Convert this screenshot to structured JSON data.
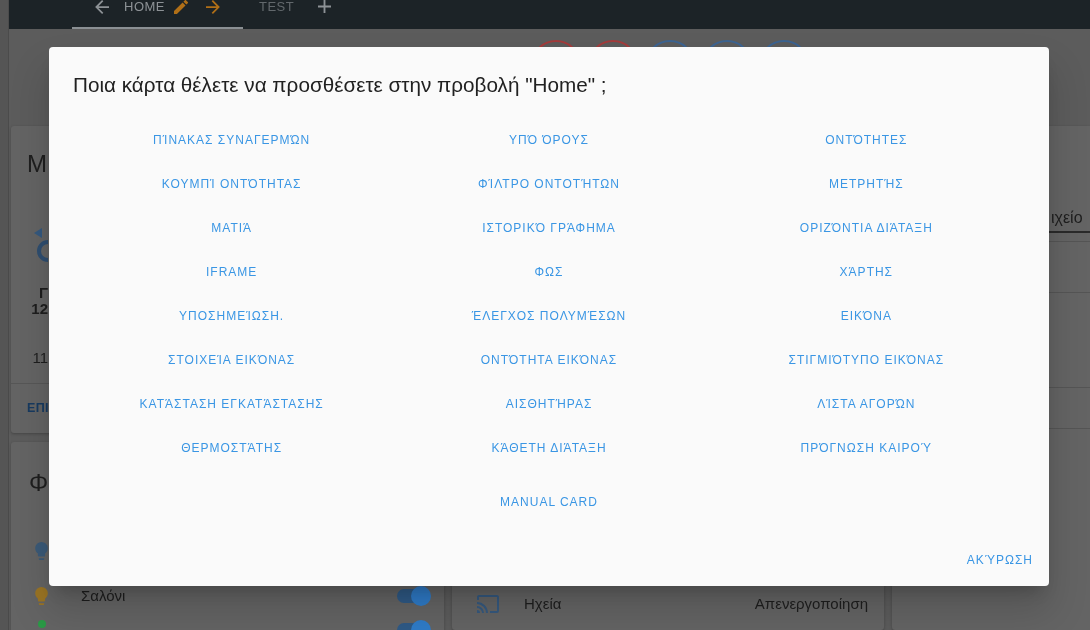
{
  "top_bar": {
    "tabs": [
      {
        "label": "HOME",
        "selected": true
      },
      {
        "label": "TEST",
        "selected": false
      }
    ]
  },
  "badges": [
    {
      "color": "#a33b3b"
    },
    {
      "color": "#a33b3b"
    },
    {
      "color": "#3b6391"
    },
    {
      "color": "#3b6391"
    },
    {
      "color": "#3b6391"
    }
  ],
  "left_column": {
    "summary_card": {
      "title": "M",
      "texts": [
        {
          "text": "Γ",
          "kind": "strong"
        },
        {
          "text": "12",
          "kind": "strong"
        },
        {
          "text": "11",
          "kind": "plain"
        }
      ],
      "action": "ΕΠΙ"
    },
    "lights_card": {
      "title": "Φ",
      "rows": [
        {
          "kind": "light",
          "on": false
        },
        {
          "kind": "light",
          "label": "Σαλόνι",
          "on": true,
          "switch": true
        },
        {
          "kind": "dot",
          "on": true,
          "switch": true
        }
      ]
    }
  },
  "middle_card": {
    "rows": [
      {
        "label": "Ηχεία",
        "value": "Απενεργοποίηση"
      }
    ]
  },
  "right_card": {
    "field_value": "ιχείο"
  },
  "dialog": {
    "title": "Ποια κάρτα θέλετε να προσθέσετε στην προβολή \"Home\" ;",
    "card_types": [
      "ΠΊΝΑΚΑΣ ΣΥΝΑΓΕΡΜΏΝ",
      "ΥΠΌ ΌΡΟΥΣ",
      "ΟΝΤΌΤΗΤΕΣ",
      "ΚΟΥΜΠΊ ΟΝΤΌΤΗΤΑΣ",
      "ΦΊΛΤΡΟ ΟΝΤΟΤΉΤΩΝ",
      "ΜΕΤΡΗΤΉΣ",
      "ΜΑΤΙΆ",
      "ΙΣΤΟΡΙΚΌ ΓΡΆΦΗΜΑ",
      "ΟΡΙΖΌΝΤΙΑ ΔΙΆΤΑΞΗ",
      "IFRAME",
      "ΦΩΣ",
      "ΧΆΡΤΗΣ",
      "ΥΠΟΣΗΜΕΊΩΣΗ.",
      "ΈΛΕΓΧΟΣ ΠΟΛΥΜΈΣΩΝ",
      "ΕΙΚΌΝΑ",
      "ΣΤΟΙΧΕΊΑ ΕΙΚΌΝΑΣ",
      "ΟΝΤΌΤΗΤΑ ΕΙΚΌΝΑΣ",
      "ΣΤΙΓΜΙΌΤΥΠΟ ΕΙΚΌΝΑΣ",
      "ΚΑΤΆΣΤΑΣΗ ΕΓΚΑΤΆΣΤΑΣΗΣ",
      "ΑΙΣΘΗΤΉΡΑΣ",
      "ΛΊΣΤΑ ΑΓΟΡΏΝ",
      "ΘΕΡΜΟΣΤΆΤΗΣ",
      "ΚΆΘΕΤΗ ΔΙΆΤΑΞΗ",
      "ΠΡΌΓΝΩΣΗ ΚΑΙΡΟΎ"
    ],
    "manual_card": "MANUAL CARD",
    "cancel": "ΑΚΎΡΩΣΗ"
  }
}
